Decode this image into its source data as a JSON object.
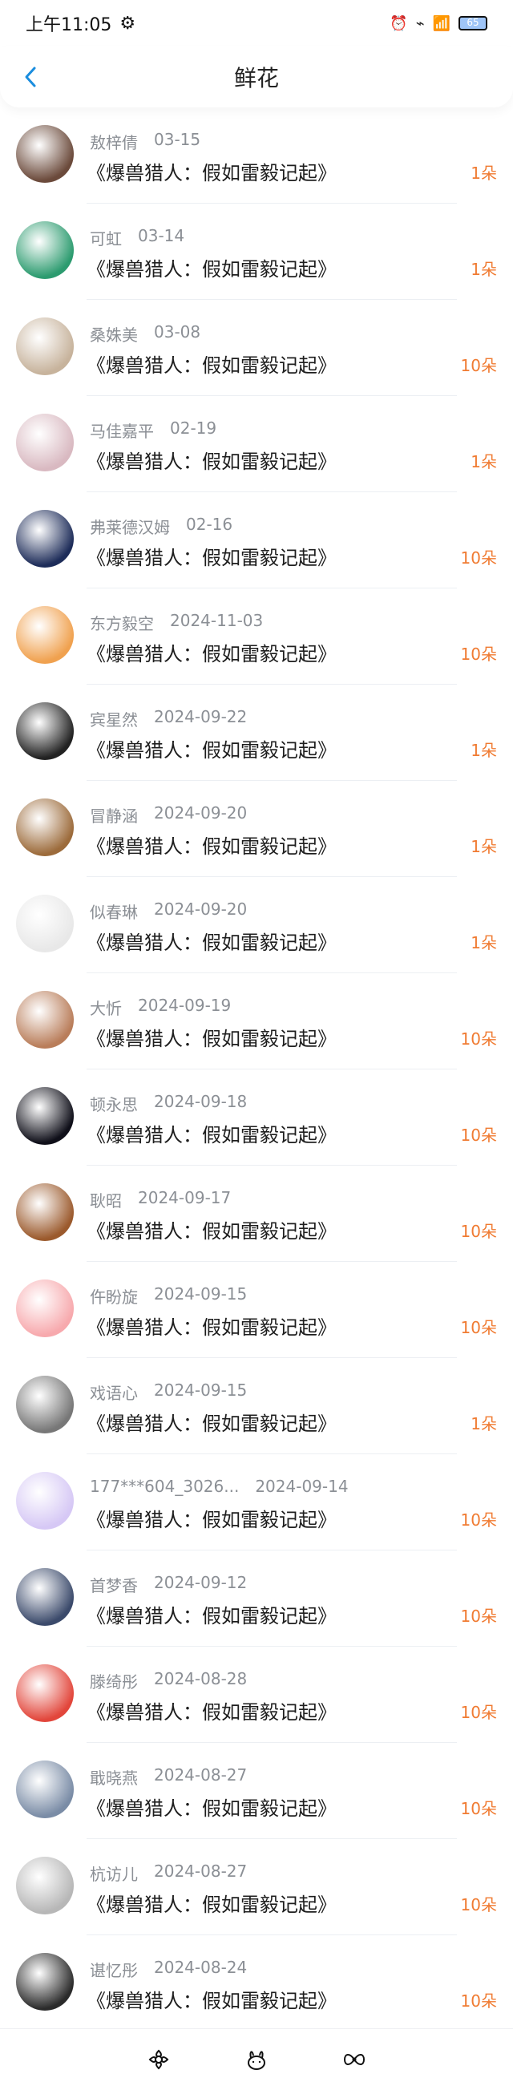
{
  "status_bar": {
    "time": "上午11:05",
    "battery": "65"
  },
  "header": {
    "title": "鲜花"
  },
  "items": [
    {
      "name": "敖梓倩",
      "date": "03-15",
      "book": "《爆兽猎人：假如雷毅记起》",
      "count": "1朵",
      "avatar_color": "#6b4a3b"
    },
    {
      "name": "可虹",
      "date": "03-14",
      "book": "《爆兽猎人：假如雷毅记起》",
      "count": "1朵",
      "avatar_color": "#2c9b6f"
    },
    {
      "name": "桑姝美",
      "date": "03-08",
      "book": "《爆兽猎人：假如雷毅记起》",
      "count": "10朵",
      "avatar_color": "#c7b39c"
    },
    {
      "name": "马佳嘉平",
      "date": "02-19",
      "book": "《爆兽猎人：假如雷毅记起》",
      "count": "1朵",
      "avatar_color": "#d9b9c1"
    },
    {
      "name": "弗莱德汉姆",
      "date": "02-16",
      "book": "《爆兽猎人：假如雷毅记起》",
      "count": "10朵",
      "avatar_color": "#1d2c59"
    },
    {
      "name": "东方毅空",
      "date": "2024-11-03",
      "book": "《爆兽猎人：假如雷毅记起》",
      "count": "10朵",
      "avatar_color": "#f0a14f"
    },
    {
      "name": "宾星然",
      "date": "2024-09-22",
      "book": "《爆兽猎人：假如雷毅记起》",
      "count": "1朵",
      "avatar_color": "#222"
    },
    {
      "name": "冒静涵",
      "date": "2024-09-20",
      "book": "《爆兽猎人：假如雷毅记起》",
      "count": "1朵",
      "avatar_color": "#9c6b3b"
    },
    {
      "name": "似春琳",
      "date": "2024-09-20",
      "book": "《爆兽猎人：假如雷毅记起》",
      "count": "1朵",
      "avatar_color": "#e8e8e8"
    },
    {
      "name": "大忻",
      "date": "2024-09-19",
      "book": "《爆兽猎人：假如雷毅记起》",
      "count": "10朵",
      "avatar_color": "#b97d5a"
    },
    {
      "name": "顿永思",
      "date": "2024-09-18",
      "book": "《爆兽猎人：假如雷毅记起》",
      "count": "10朵",
      "avatar_color": "#0f0f19"
    },
    {
      "name": "耿昭",
      "date": "2024-09-17",
      "book": "《爆兽猎人：假如雷毅记起》",
      "count": "10朵",
      "avatar_color": "#9b5a2d"
    },
    {
      "name": "仵盼旋",
      "date": "2024-09-15",
      "book": "《爆兽猎人：假如雷毅记起》",
      "count": "10朵",
      "avatar_color": "#f7a9ad"
    },
    {
      "name": "戏语心",
      "date": "2024-09-15",
      "book": "《爆兽猎人：假如雷毅记起》",
      "count": "1朵",
      "avatar_color": "#777"
    },
    {
      "name": "177***604_3026...",
      "date": "2024-09-14",
      "book": "《爆兽猎人：假如雷毅记起》",
      "count": "10朵",
      "avatar_color": "#d6c8f5"
    },
    {
      "name": "首梦香",
      "date": "2024-09-12",
      "book": "《爆兽猎人：假如雷毅记起》",
      "count": "10朵",
      "avatar_color": "#3b4a6b"
    },
    {
      "name": "滕绮彤",
      "date": "2024-08-28",
      "book": "《爆兽猎人：假如雷毅记起》",
      "count": "10朵",
      "avatar_color": "#e2463b"
    },
    {
      "name": "戢晓燕",
      "date": "2024-08-27",
      "book": "《爆兽猎人：假如雷毅记起》",
      "count": "10朵",
      "avatar_color": "#7a8ca6"
    },
    {
      "name": "杭访儿",
      "date": "2024-08-27",
      "book": "《爆兽猎人：假如雷毅记起》",
      "count": "10朵",
      "avatar_color": "#b7b7b7"
    },
    {
      "name": "谌忆彤",
      "date": "2024-08-24",
      "book": "《爆兽猎人：假如雷毅记起》",
      "count": "10朵",
      "avatar_color": "#2b2b2b"
    }
  ],
  "bottom_bar": {
    "icons": [
      "flower-icon",
      "bunny-icon",
      "bow-icon"
    ]
  }
}
